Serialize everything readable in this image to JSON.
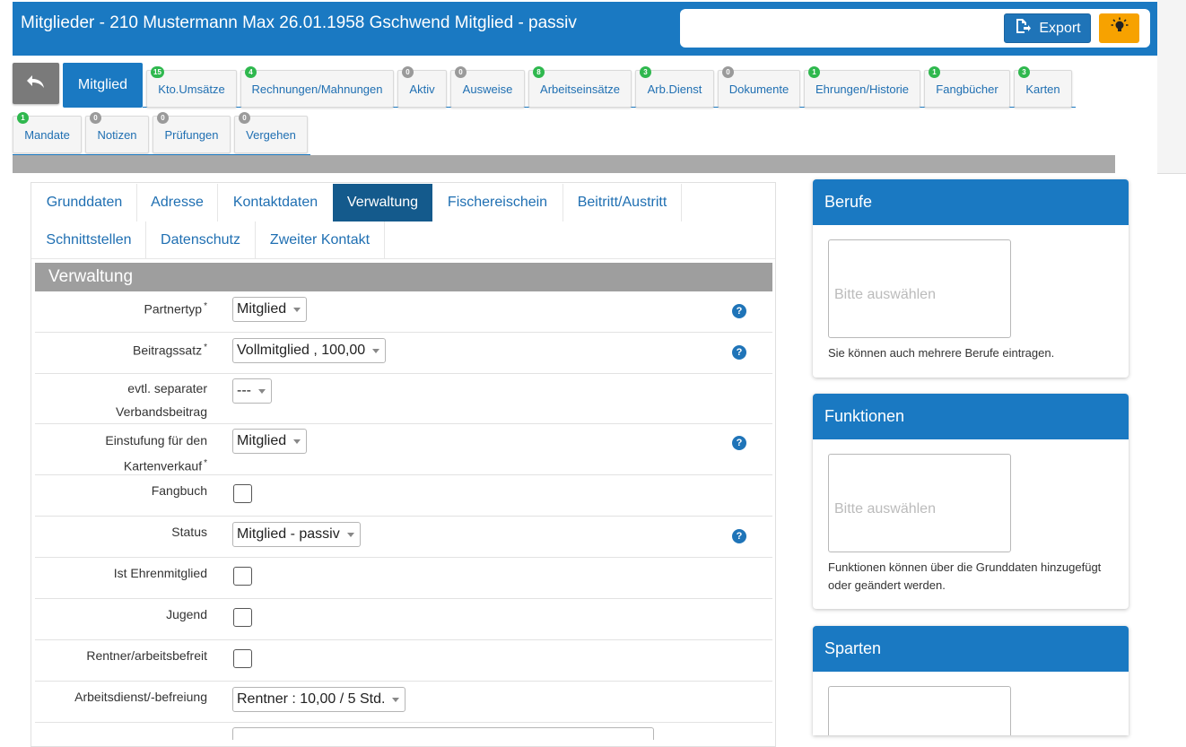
{
  "header": {
    "title": "Mitglieder - 210 Mustermann Max 26.01.1958 Gschwend Mitglied - passiv",
    "export_label": "Export"
  },
  "tabs": {
    "main_label": "Mitglied",
    "row1": [
      {
        "label": "Kto.Umsätze",
        "badge": "15",
        "badge_color": "green"
      },
      {
        "label": "Rechnungen/Mahnungen",
        "badge": "4",
        "badge_color": "green"
      },
      {
        "label": "Aktiv",
        "badge": "0",
        "badge_color": "gray"
      },
      {
        "label": "Ausweise",
        "badge": "0",
        "badge_color": "gray"
      },
      {
        "label": "Arbeitseinsätze",
        "badge": "8",
        "badge_color": "green"
      },
      {
        "label": "Arb.Dienst",
        "badge": "3",
        "badge_color": "green"
      },
      {
        "label": "Dokumente",
        "badge": "0",
        "badge_color": "gray"
      },
      {
        "label": "Ehrungen/Historie",
        "badge": "1",
        "badge_color": "green"
      },
      {
        "label": "Fangbücher",
        "badge": "1",
        "badge_color": "green"
      },
      {
        "label": "Karten",
        "badge": "3",
        "badge_color": "green"
      }
    ],
    "row2": [
      {
        "label": "Mandate",
        "badge": "1",
        "badge_color": "green"
      },
      {
        "label": "Notizen",
        "badge": "0",
        "badge_color": "gray"
      },
      {
        "label": "Prüfungen",
        "badge": "0",
        "badge_color": "gray"
      },
      {
        "label": "Vergehen",
        "badge": "0",
        "badge_color": "gray"
      }
    ]
  },
  "subtabs": {
    "grunddaten": "Grunddaten",
    "adresse": "Adresse",
    "kontaktdaten": "Kontaktdaten",
    "verwaltung": "Verwaltung",
    "fischereischein": "Fischereischein",
    "beitritt": "Beitritt/Austritt",
    "schnittstellen": "Schnittstellen",
    "datenschutz": "Datenschutz",
    "zweiter_kontakt": "Zweiter Kontakt"
  },
  "form": {
    "section_title": "Verwaltung",
    "partnertyp_label": "Partnertyp",
    "partnertyp_value": "Mitglied",
    "beitragssatz_label": "Beitragssatz",
    "beitragssatz_value": "Vollmitglied , 100,00",
    "verband_label_1": "evtl. separater",
    "verband_label_2": "Verbandsbeitrag",
    "verband_value": "---",
    "einstufung_label_1": "Einstufung für den",
    "einstufung_label_2": "Kartenverkauf",
    "einstufung_value": "Mitglied",
    "fangbuch_label": "Fangbuch",
    "status_label": "Status",
    "status_value": "Mitglied - passiv",
    "ehrenmitglied_label": "Ist Ehrenmitglied",
    "jugend_label": "Jugend",
    "rentner_label": "Rentner/arbeitsbefreit",
    "arbeitsdienst_label": "Arbeitsdienst/-befreiung",
    "arbeitsdienst_value": "Rentner : 10,00 / 5 Std.",
    "required_mark": "*",
    "help_glyph": "?"
  },
  "cards": {
    "berufe": {
      "title": "Berufe",
      "placeholder": "Bitte auswählen",
      "note": "Sie können auch mehrere Berufe eintragen."
    },
    "funktionen": {
      "title": "Funktionen",
      "placeholder": "Bitte auswählen",
      "note_1": "Funktionen können über die Grunddaten hinzugefügt",
      "note_2": "oder geändert werden."
    },
    "sparten": {
      "title": "Sparten"
    }
  },
  "colors": {
    "primary": "#1a79c2",
    "active_subtab": "#145a8c",
    "bulb_button": "#f7a200",
    "badge_green": "#2fb84e",
    "badge_gray": "#9a9a9a"
  },
  "icons": {
    "back": "undo-arrow-icon",
    "export": "export-file-icon",
    "bulb": "lightbulb-icon",
    "help": "help-circle-icon"
  }
}
